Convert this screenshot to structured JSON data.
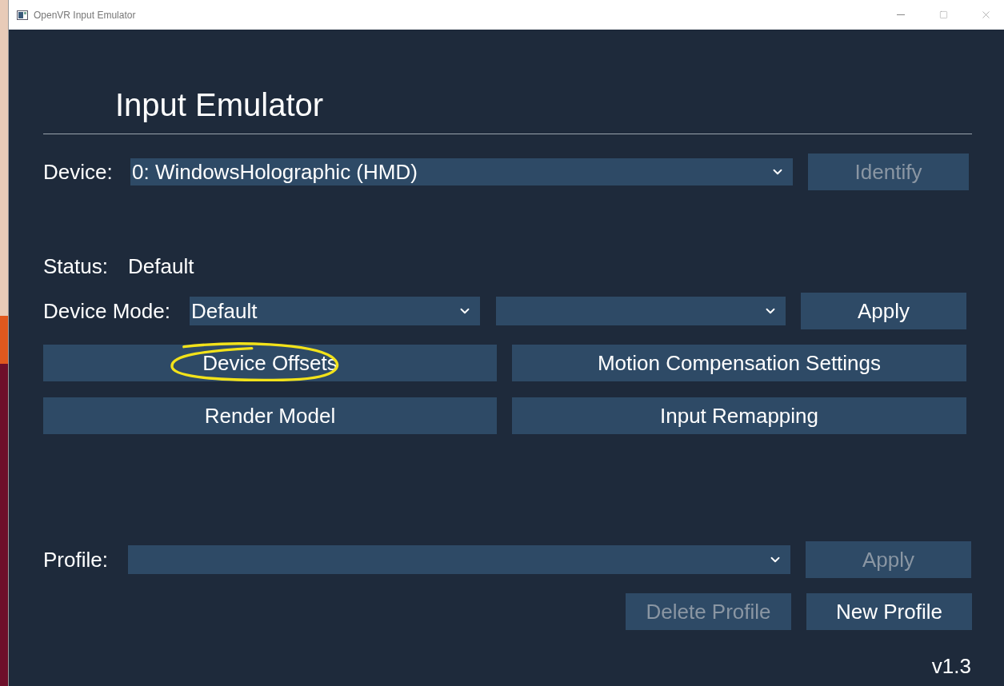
{
  "window": {
    "title": "OpenVR Input Emulator"
  },
  "heading": "Input Emulator",
  "device": {
    "label": "Device:",
    "value": "0: WindowsHolographic (HMD)",
    "button": {
      "label": "Identify",
      "disabled": true
    }
  },
  "status": {
    "label": "Status:",
    "value": "Default"
  },
  "device_mode": {
    "label": "Device Mode:",
    "value": "Default",
    "button": {
      "label": "Apply",
      "disabled": false
    }
  },
  "actions": [
    {
      "label": "Device Offsets",
      "circled": true
    },
    {
      "label": "Motion Compensation Settings",
      "circled": false
    },
    {
      "label": "Render Model",
      "circled": false
    },
    {
      "label": "Input Remapping",
      "circled": false
    }
  ],
  "profile": {
    "label": "Profile:",
    "button": {
      "label": "Apply",
      "disabled": true
    }
  },
  "profile_buttons": [
    {
      "label": "Delete Profile",
      "disabled": true
    },
    {
      "label": "New Profile",
      "disabled": false
    }
  ],
  "version": "v1.3"
}
